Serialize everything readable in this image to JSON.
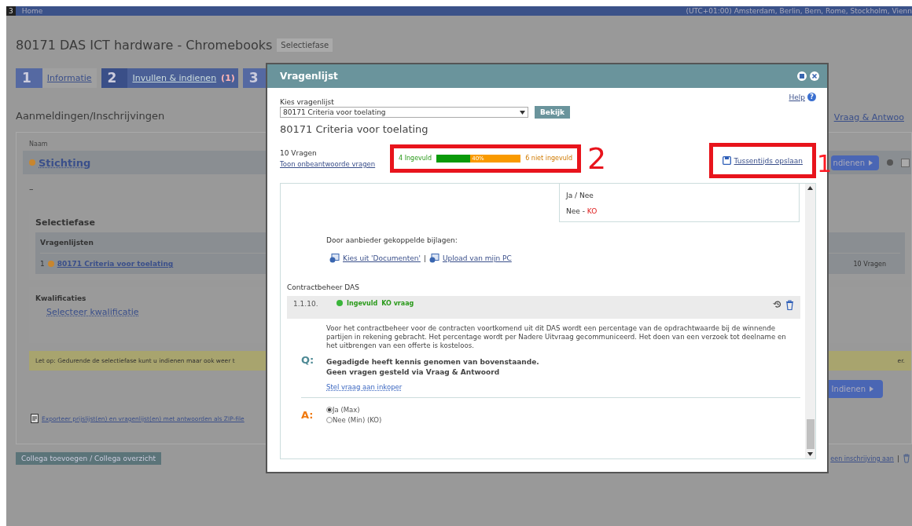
{
  "top_bar": {
    "logo": "3",
    "home": "Home",
    "timezone": "(UTC+01:00) Amsterdam, Berlin, Bern, Rome, Stockholm, Vienn"
  },
  "page": {
    "title": "80171 DAS ICT hardware - Chromebooks",
    "phase_badge": "Selectiefase",
    "steps": [
      {
        "number": "1",
        "label": "Informatie",
        "selected": false
      },
      {
        "number": "2",
        "label": "Invullen & indienen",
        "count": "(1)",
        "selected": true
      },
      {
        "number": "3",
        "selected": false
      }
    ],
    "section_title": "Aanmeldingen/Inschrijvingen",
    "qa_link": "Vraag & Antwoo",
    "table_header": "Naam",
    "organisation": "Stichting",
    "submit_top": "ndienen",
    "row_checkbox": {
      "checked": false
    },
    "dash": "–",
    "phase": {
      "title": "Selectiefase",
      "subheader": "Vragenlijsten",
      "rows": [
        {
          "index": "1",
          "name": "80171 Criteria voor toelating",
          "count": "10 Vragen"
        }
      ]
    },
    "qualifications": {
      "title": "Kwalificaties",
      "link": "Selecteer kwalificatie"
    },
    "notice_start": "Let op: Gedurende de selectiefase kunt u indienen maar ook weer t",
    "notice_end": "er.",
    "submit_bottom": "Indienen",
    "export_link": "Exporteer prijslijst(en) en vragenlijst(en) met antwoorden als ZIP-file",
    "colleague_button": "Collega toevoegen / Collega overzicht",
    "footer_link": "een inschrijving aan",
    "footer_separator": "|"
  },
  "modal": {
    "title": "Vragenlijst",
    "help": "Help",
    "help_mark": "?",
    "select_label": "Kies vragenlijst",
    "select_value": "80171 Criteria voor toelating",
    "view_button": "Bekijk",
    "heading": "80171 Criteria voor toelating",
    "question_count": "10 Vragen",
    "show_unanswered": "Toon onbeantwoorde vragen",
    "progress": {
      "filled_label": "4 Ingevuld",
      "level": 0.4,
      "percent": "40%",
      "unfilled_label": "6 niet ingevuld"
    },
    "save_link": "Tussentijds opslaan",
    "options": [
      {
        "text": "Ja / Nee"
      },
      {
        "text": "Nee - ",
        "ko": "KO"
      }
    ],
    "attachments_label": "Door aanbieder gekoppelde bijlagen:",
    "attachment_links": [
      "Kies uit 'Documenten'",
      "Upload van mijn PC"
    ],
    "attachment_separator": "|",
    "section": "Contractbeheer DAS",
    "question": {
      "number": "1.1.10.",
      "status": "Ingevuld",
      "ko": "KO vraag",
      "q_label": "Q:",
      "text": "Voor het contractbeheer voor de contracten voortkomend uit dit DAS wordt een percentage van de opdrachtwaarde bij de winnende partijen in rekening gebracht. Het percentage wordt per Nadere Uitvraag gecommuniceerd. Het doen van een verzoek tot deelname en het uitbrengen van een offerte is kosteloos.",
      "bold_lines": [
        "Gegadigde heeft kennis genomen van bovenstaande.",
        "Geen vragen gesteld via Vraag & Antwoord"
      ],
      "ask_link": "Stel vraag aan inkoper",
      "a_label": "A:",
      "answers": [
        {
          "label": "Ja (Max)",
          "selected": true
        },
        {
          "label": "Nee (Min) (KO)",
          "selected": false
        }
      ]
    }
  },
  "annotations": [
    {
      "number": "2"
    },
    {
      "number": "1"
    }
  ]
}
